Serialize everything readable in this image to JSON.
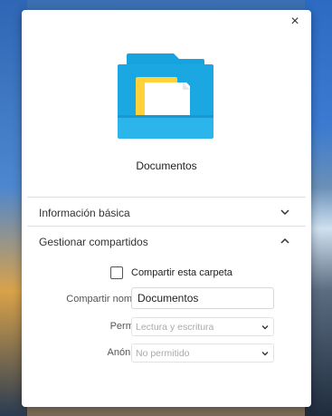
{
  "dialog": {
    "close_symbol": "×",
    "folder_name": "Documentos",
    "folder_icon": "folder-icon"
  },
  "sections": {
    "basic_info_label": "Información básica",
    "sharing_label": "Gestionar compartidos"
  },
  "sharing": {
    "share_checkbox_label": "Compartir esta carpeta",
    "share_checked": false,
    "share_name_label": "Compartir nombre:",
    "share_name_value": "Documentos",
    "permission_label": "Permiso:",
    "permission_value": "Lectura y escritura",
    "anonymous_label": "Anónimo:",
    "anonymous_value": "No permitido"
  },
  "colors": {
    "folder_blue": "#1ea6e0",
    "folder_yellow": "#ffd13a"
  }
}
